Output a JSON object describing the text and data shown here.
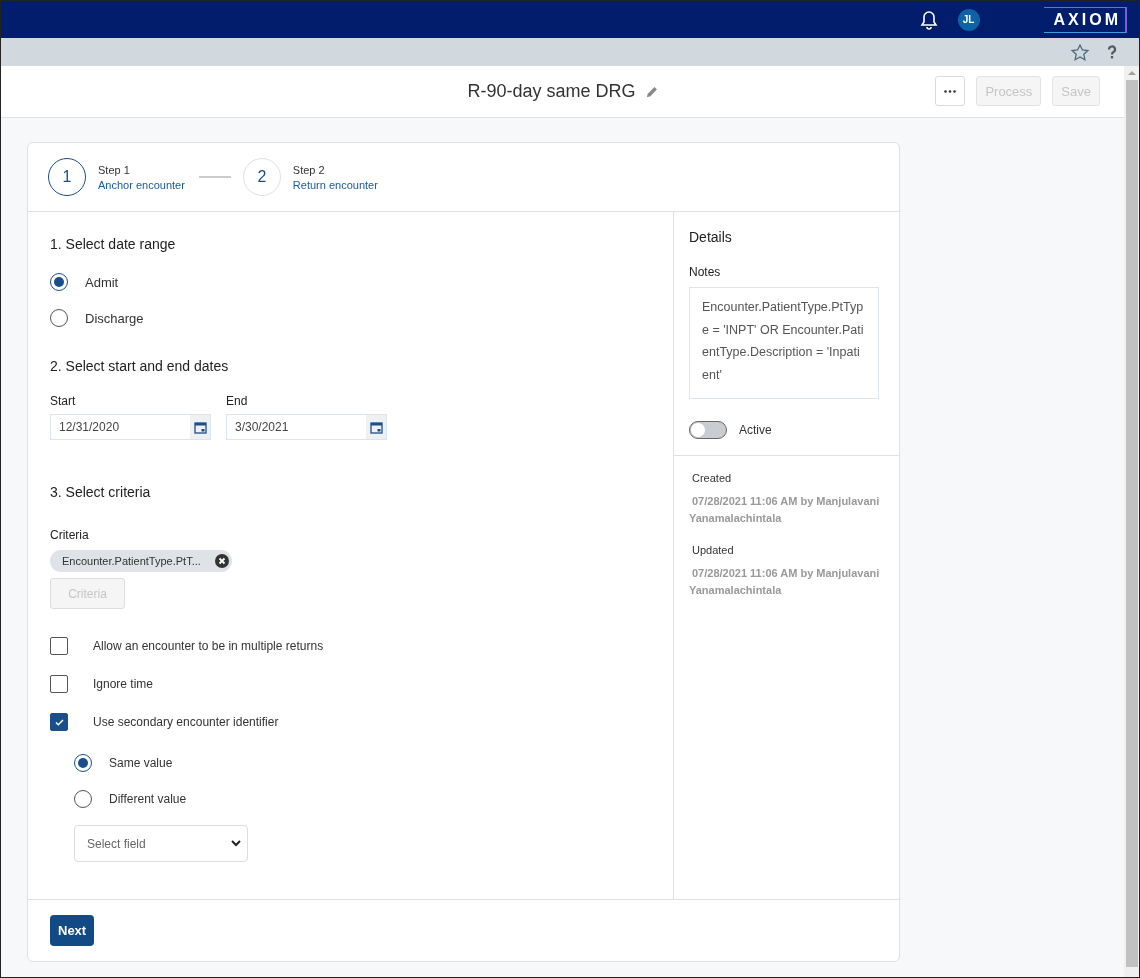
{
  "top_bar": {
    "avatar_initials": "JL",
    "logo": "AXIOM"
  },
  "header": {
    "title": "R-90-day same DRG",
    "actions": [
      {
        "label": "Process",
        "disabled": true
      },
      {
        "label": "Save",
        "disabled": true
      }
    ]
  },
  "steps": [
    {
      "number": "1",
      "title": "Step 1",
      "label": "Anchor encounter",
      "selected": true
    },
    {
      "number": "2",
      "title": "Step 2",
      "label": "Return encounter",
      "selected": false
    }
  ],
  "form": {
    "date_range": {
      "heading": "1. Select date range",
      "options": [
        {
          "label": "Admit",
          "selected": true
        },
        {
          "label": "Discharge",
          "selected": false
        }
      ]
    },
    "dates": {
      "heading": "2. Select start and end dates",
      "fields": [
        {
          "label": "Start",
          "value": "12/31/2020"
        },
        {
          "label": "End",
          "value": "3/30/2021"
        }
      ]
    },
    "criteria": {
      "heading": "3. Select criteria",
      "label": "Criteria",
      "chip": "Encounter.PatientType.PtT...",
      "button": "Criteria",
      "button_disabled": true
    },
    "options": [
      {
        "label": "Allow an encounter to be in multiple returns",
        "checked": false
      },
      {
        "label": "Ignore time",
        "checked": false
      },
      {
        "label": "Use secondary encounter identifier",
        "checked": true
      }
    ],
    "identifier": {
      "options": [
        {
          "label": "Same value",
          "selected": true
        },
        {
          "label": "Different value",
          "selected": false
        }
      ],
      "select_placeholder": "Select field"
    },
    "next_button": "Next"
  },
  "details": {
    "heading": "Details",
    "notes_label": "Notes",
    "notes": "Encounter.PatientType.PtType = 'INPT' OR Encounter.PatientType.Description = 'Inpatient'",
    "active_label": "Active",
    "active": false,
    "history": [
      {
        "label": "Created",
        "text": "07/28/2021 11:06 AM by Manjulavani Yanamalachintala"
      },
      {
        "label": "Updated",
        "text": "07/28/2021 11:06 AM by Manjulavani Yanamalachintala"
      }
    ]
  }
}
